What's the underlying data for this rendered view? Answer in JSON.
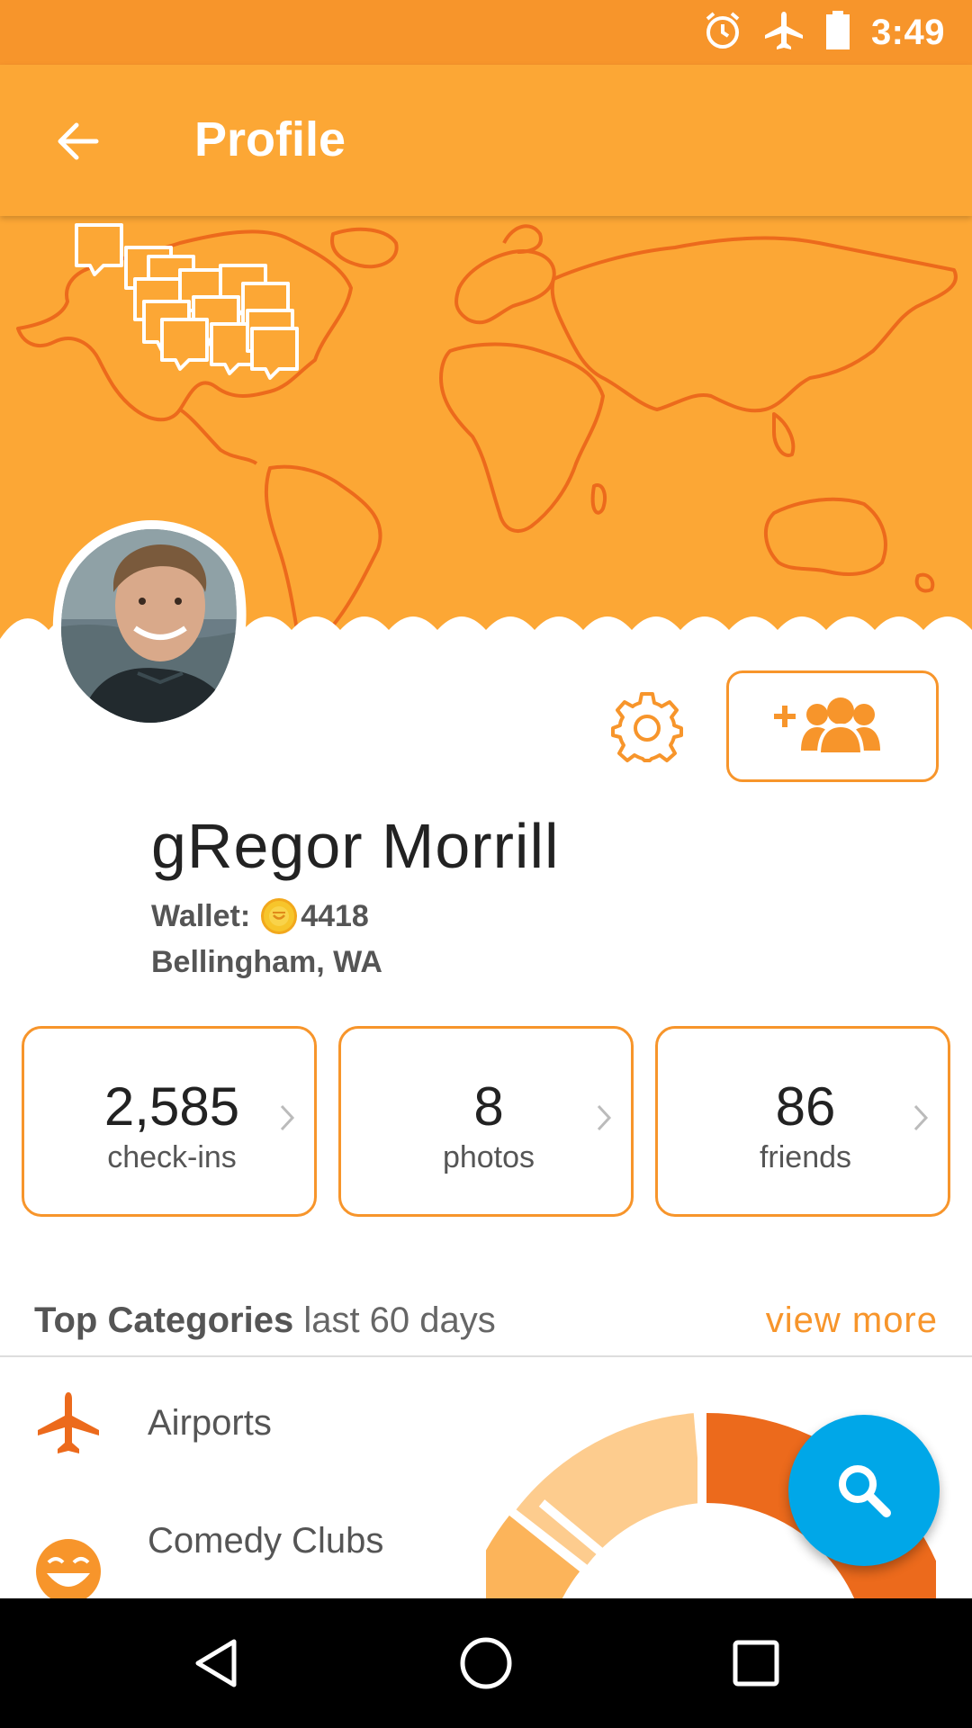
{
  "status_bar": {
    "time": "3:49",
    "icons": [
      "alarm-icon",
      "airplane-mode-icon",
      "battery-icon"
    ]
  },
  "app_bar": {
    "title": "Profile",
    "back_icon": "arrow-left-icon"
  },
  "profile": {
    "name": "gRegor Morrill",
    "wallet_label": "Wallet:",
    "wallet_value": "4418",
    "location": "Bellingham, WA",
    "settings_icon": "gear-icon",
    "add_friend_icon": "add-friends-icon"
  },
  "stats": [
    {
      "value": "2,585",
      "label": "check-ins"
    },
    {
      "value": "8",
      "label": "photos"
    },
    {
      "value": "86",
      "label": "friends"
    }
  ],
  "top_categories": {
    "title": "Top Categories",
    "subtitle": "last 60 days",
    "view_more": "view more",
    "items": [
      {
        "label": "Airports",
        "icon": "airplane-icon"
      },
      {
        "label": "Comedy Clubs",
        "icon": "laughing-face-icon"
      }
    ]
  },
  "fab": {
    "icon": "search-icon"
  },
  "nav": {
    "back": "nav-back-icon",
    "home": "nav-home-icon",
    "recents": "nav-recents-icon"
  },
  "colors": {
    "primary": "#fca735",
    "status": "#f7952b",
    "map_line": "#ec6a1c",
    "fab": "#00a7e8"
  }
}
